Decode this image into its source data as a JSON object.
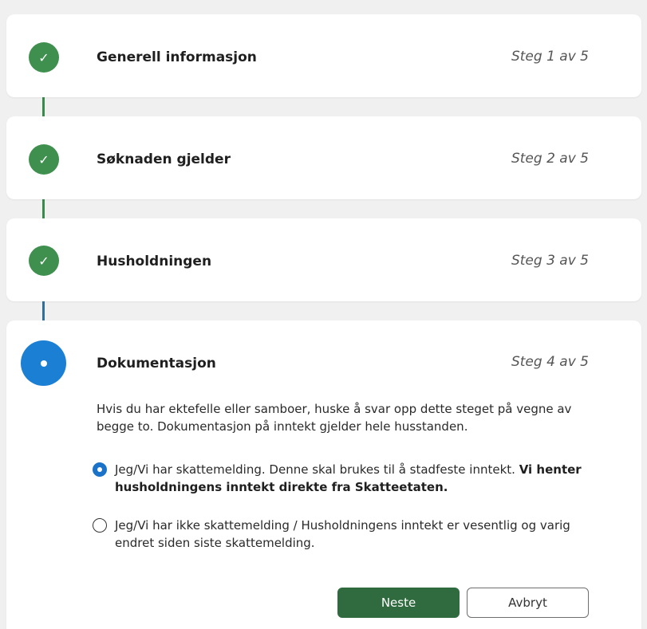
{
  "steps": [
    {
      "title": "Generell informasjon",
      "count": "Steg 1 av 5",
      "status": "done",
      "icon": "check-icon"
    },
    {
      "title": "Søknaden gjelder",
      "count": "Steg 2 av 5",
      "status": "done",
      "icon": "check-icon"
    },
    {
      "title": "Husholdningen",
      "count": "Steg 3 av 5",
      "status": "done",
      "icon": "check-icon"
    },
    {
      "title": "Dokumentasjon",
      "count": "Steg 4 av 5",
      "status": "active",
      "icon": "dot-icon"
    }
  ],
  "active_step": {
    "intro": "Hvis du har ektefelle eller samboer, huske å svar opp dette steget på vegne av begge to. Dokumentasjon på inntekt gjelder hele husstanden.",
    "options": [
      {
        "text": "Jeg/Vi har skattemelding. Denne skal brukes til å stadfeste inntekt.",
        "bold_text": "Vi henter husholdningens inntekt direkte fra Skatteetaten.",
        "selected": true
      },
      {
        "text": "Jeg/Vi har ikke skattemelding / Husholdningens inntekt er vesentlig og varig endret siden siste skattemelding.",
        "bold_text": "",
        "selected": false
      }
    ],
    "next_label": "Neste",
    "cancel_label": "Avbryt"
  },
  "colors": {
    "done": "#3f8f4f",
    "active": "#1b7fd4",
    "next_button": "#2f6b3e",
    "pending_line": "#cfcfcf"
  }
}
